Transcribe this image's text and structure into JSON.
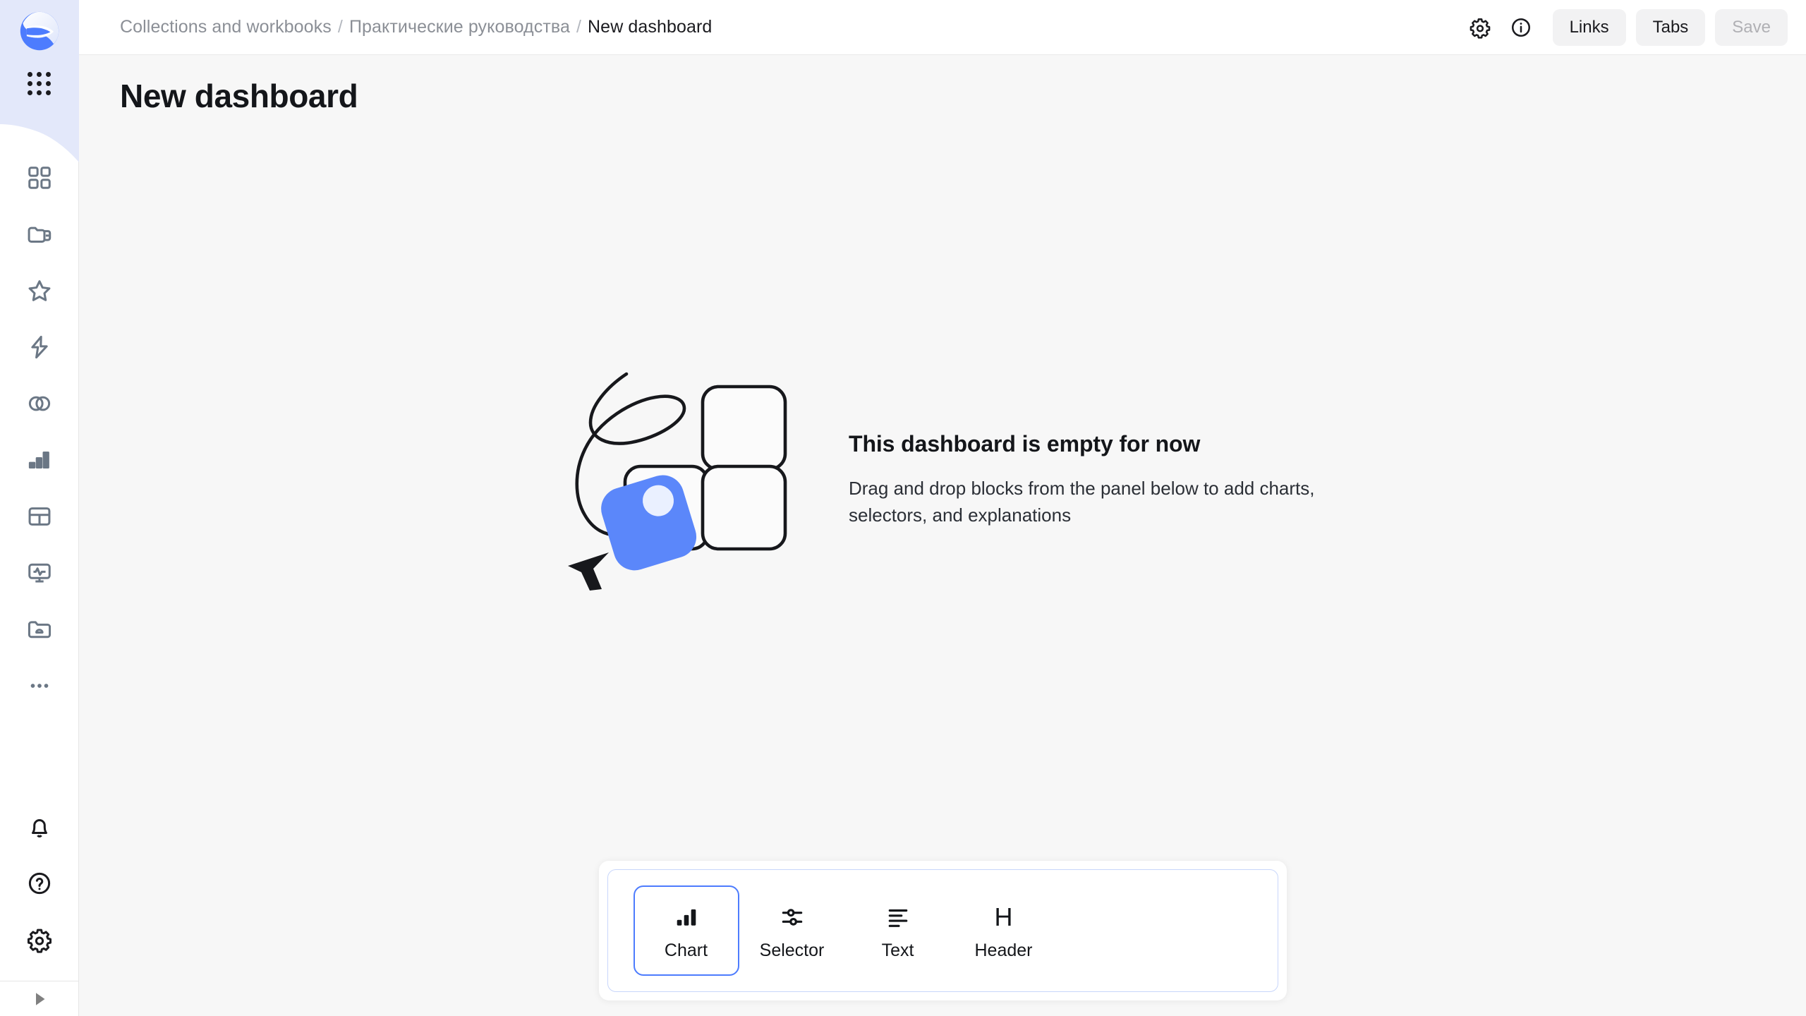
{
  "app": {
    "logo_name": "datalens-logo",
    "accent_color": "#4d7cfe",
    "background_color": "#f7f7f7"
  },
  "sidebar": {
    "apps_button_label": "All services",
    "nav_items": [
      {
        "icon": "squares-4-icon",
        "label": "Navigation"
      },
      {
        "icon": "folder-collections-icon",
        "label": "Collections and workbooks"
      },
      {
        "icon": "star-icon",
        "label": "Favorites"
      },
      {
        "icon": "lightning-icon",
        "label": "Quick start"
      },
      {
        "icon": "connections-icon",
        "label": "Connections"
      },
      {
        "icon": "bar-chart-icon",
        "label": "Charts"
      },
      {
        "icon": "dataset-grid-icon",
        "label": "Datasets"
      },
      {
        "icon": "monitoring-icon",
        "label": "Monitoring"
      },
      {
        "icon": "folder-cloud-icon",
        "label": "Cloud folder"
      },
      {
        "icon": "ellipsis-icon",
        "label": "More"
      }
    ],
    "bottom_items": [
      {
        "icon": "bell-icon",
        "label": "Notifications"
      },
      {
        "icon": "question-circle-icon",
        "label": "Help"
      },
      {
        "icon": "gear-icon",
        "label": "Settings"
      }
    ],
    "footer": {
      "icon": "collapse-arrow-icon",
      "label": "Expand sidebar"
    }
  },
  "header": {
    "breadcrumb": [
      {
        "label": "Collections and workbooks",
        "current": false
      },
      {
        "label": "Практические руководства",
        "current": false
      },
      {
        "label": "New dashboard",
        "current": true
      }
    ],
    "separator": "/",
    "actions": {
      "settings_icon": "gear-icon",
      "info_icon": "info-circle-icon",
      "links_label": "Links",
      "tabs_label": "Tabs",
      "save_label": "Save",
      "save_disabled": true
    }
  },
  "page": {
    "title": "New dashboard"
  },
  "empty_state": {
    "illustration_name": "empty-dashboard-illustration",
    "title": "This dashboard is empty for now",
    "subtitle": "Drag and drop blocks from the panel below to add charts, selectors, and explanations"
  },
  "block_panel": {
    "items": [
      {
        "id": "chart",
        "label": "Chart",
        "icon": "bar-chart-icon",
        "active": true
      },
      {
        "id": "selector",
        "label": "Selector",
        "icon": "sliders-icon",
        "active": false
      },
      {
        "id": "text",
        "label": "Text",
        "icon": "text-lines-icon",
        "active": false
      },
      {
        "id": "header",
        "label": "Header",
        "icon": "heading-h-icon",
        "active": false
      }
    ]
  }
}
